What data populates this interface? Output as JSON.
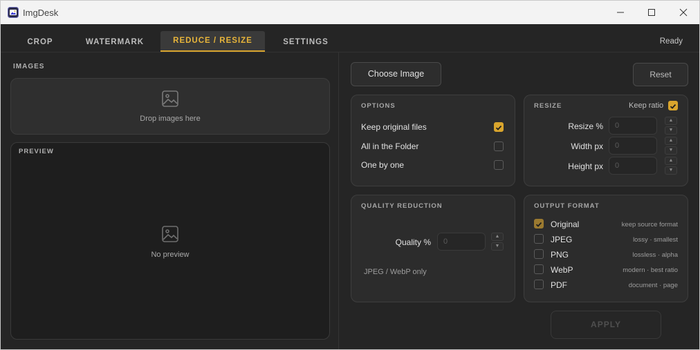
{
  "window": {
    "title": "ImgDesk"
  },
  "tabs": [
    {
      "label": "CROP"
    },
    {
      "label": "WATERMARK"
    },
    {
      "label": "REDUCE / RESIZE"
    },
    {
      "label": "SETTINGS"
    }
  ],
  "status": "Ready",
  "images": {
    "label": "IMAGES",
    "drop_text": "Drop images here"
  },
  "preview": {
    "label": "PREVIEW",
    "empty_text": "No preview"
  },
  "actions": {
    "choose": "Choose Image",
    "reset": "Reset",
    "apply": "APPLY"
  },
  "options": {
    "title": "OPTIONS",
    "items": [
      {
        "label": "Keep original files",
        "checked": true
      },
      {
        "label": "All in the Folder",
        "checked": false
      },
      {
        "label": "One by one",
        "checked": false
      }
    ]
  },
  "resize": {
    "title": "RESIZE",
    "keep_ratio_label": "Keep ratio",
    "keep_ratio": true,
    "fields": [
      {
        "label": "Resize %",
        "placeholder": "0"
      },
      {
        "label": "Width px",
        "placeholder": "0"
      },
      {
        "label": "Height px",
        "placeholder": "0"
      }
    ]
  },
  "quality": {
    "title": "QUALITY REDUCTION",
    "label": "Quality %",
    "placeholder": "0",
    "note": "JPEG / WebP only"
  },
  "output": {
    "title": "OUTPUT FORMAT",
    "formats": [
      {
        "name": "Original",
        "desc": "keep source format",
        "checked": true
      },
      {
        "name": "JPEG",
        "desc": "lossy · smallest",
        "checked": false
      },
      {
        "name": "PNG",
        "desc": "lossless · alpha",
        "checked": false
      },
      {
        "name": "WebP",
        "desc": "modern · best ratio",
        "checked": false
      },
      {
        "name": "PDF",
        "desc": "document · page",
        "checked": false
      }
    ]
  },
  "colors": {
    "accent": "#d9a52d",
    "background": "#252525",
    "card": "#2c2c2c"
  }
}
